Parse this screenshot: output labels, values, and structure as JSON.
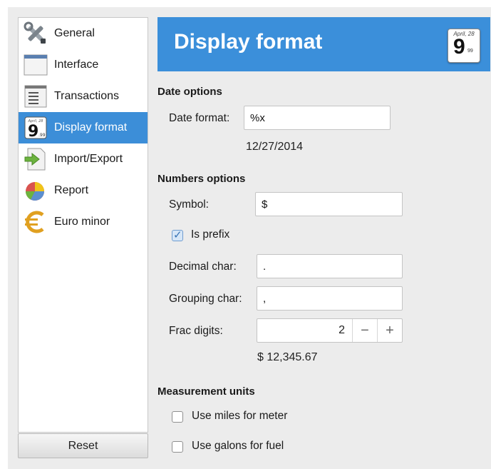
{
  "sidebar": {
    "items": [
      {
        "label": "General",
        "icon": "tools-icon"
      },
      {
        "label": "Interface",
        "icon": "window-icon"
      },
      {
        "label": "Transactions",
        "icon": "document-list-icon"
      },
      {
        "label": "Display format",
        "icon": "calendar-icon",
        "active": true
      },
      {
        "label": "Import/Export",
        "icon": "import-export-icon"
      },
      {
        "label": "Report",
        "icon": "pie-chart-icon"
      },
      {
        "label": "Euro minor",
        "icon": "euro-icon"
      }
    ],
    "reset_label": "Reset"
  },
  "header": {
    "title": "Display format",
    "icon_month": "April, 28",
    "icon_day": "9",
    "icon_cents": "99",
    "accent_color": "#3b8fda"
  },
  "date_options": {
    "title": "Date options",
    "format_label": "Date format:",
    "format_value": "%x",
    "preview": "12/27/2014"
  },
  "numbers_options": {
    "title": "Numbers options",
    "symbol_label": "Symbol:",
    "symbol_value": "$",
    "is_prefix_label": "Is prefix",
    "is_prefix_checked": true,
    "decimal_label": "Decimal char:",
    "decimal_value": ".",
    "grouping_label": "Grouping char:",
    "grouping_value": ",",
    "frac_label": "Frac digits:",
    "frac_value": "2",
    "minus": "−",
    "plus": "+",
    "preview": "$ 12,345.67"
  },
  "measurement_units": {
    "title": "Measurement units",
    "miles_label": "Use miles for meter",
    "miles_checked": false,
    "galons_label": "Use galons for fuel",
    "galons_checked": false
  }
}
